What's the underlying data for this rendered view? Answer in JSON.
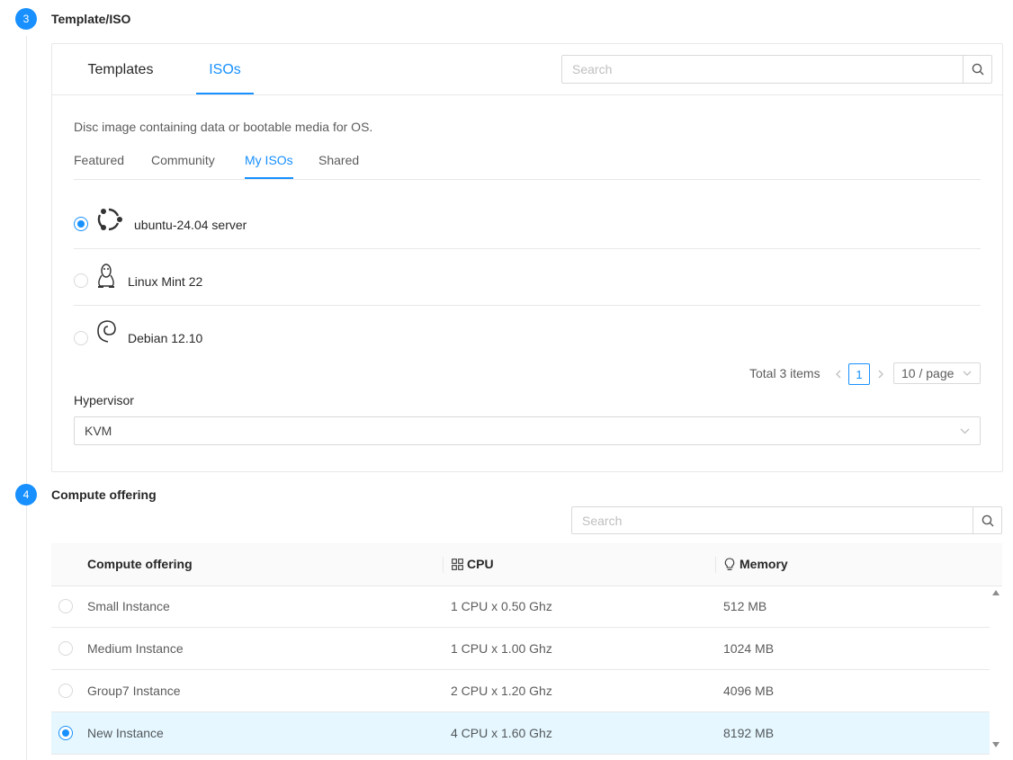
{
  "steps": {
    "template": {
      "number": "3",
      "title": "Template/ISO"
    },
    "compute": {
      "number": "4",
      "title": "Compute offering"
    }
  },
  "template_card": {
    "tabs": [
      {
        "label": "Templates",
        "active": false
      },
      {
        "label": "ISOs",
        "active": true
      }
    ],
    "search": {
      "placeholder": "Search",
      "value": ""
    },
    "description": "Disc image containing data or bootable media for OS.",
    "filter_tabs": [
      {
        "label": "Featured",
        "active": false
      },
      {
        "label": "Community",
        "active": false
      },
      {
        "label": "My ISOs",
        "active": true
      },
      {
        "label": "Shared",
        "active": false
      }
    ],
    "isos": [
      {
        "name": "ubuntu-24.04 server",
        "icon": "ubuntu-icon",
        "selected": true
      },
      {
        "name": "Linux Mint 22",
        "icon": "linux-tux-icon",
        "selected": false
      },
      {
        "name": "Debian 12.10",
        "icon": "debian-icon",
        "selected": false
      }
    ],
    "pagination": {
      "total_text": "Total 3 items",
      "current_page": "1",
      "page_size": "10 / page"
    },
    "hypervisor": {
      "label": "Hypervisor",
      "value": "KVM"
    }
  },
  "compute_offering": {
    "search": {
      "placeholder": "Search",
      "value": ""
    },
    "columns": [
      "Compute offering",
      "CPU",
      "Memory"
    ],
    "rows": [
      {
        "name": "Small Instance",
        "cpu": "1 CPU x 0.50 Ghz",
        "memory": "512 MB",
        "selected": false
      },
      {
        "name": "Medium Instance",
        "cpu": "1 CPU x 1.00 Ghz",
        "memory": "1024 MB",
        "selected": false
      },
      {
        "name": "Group7 Instance",
        "cpu": "2 CPU x 1.20 Ghz",
        "memory": "4096 MB",
        "selected": false
      },
      {
        "name": "New Instance",
        "cpu": "4 CPU x 1.60 Ghz",
        "memory": "8192 MB",
        "selected": true
      }
    ]
  },
  "colors": {
    "primary": "#1890ff",
    "selected_row": "#e6f7ff",
    "border": "#e8e8e8"
  }
}
